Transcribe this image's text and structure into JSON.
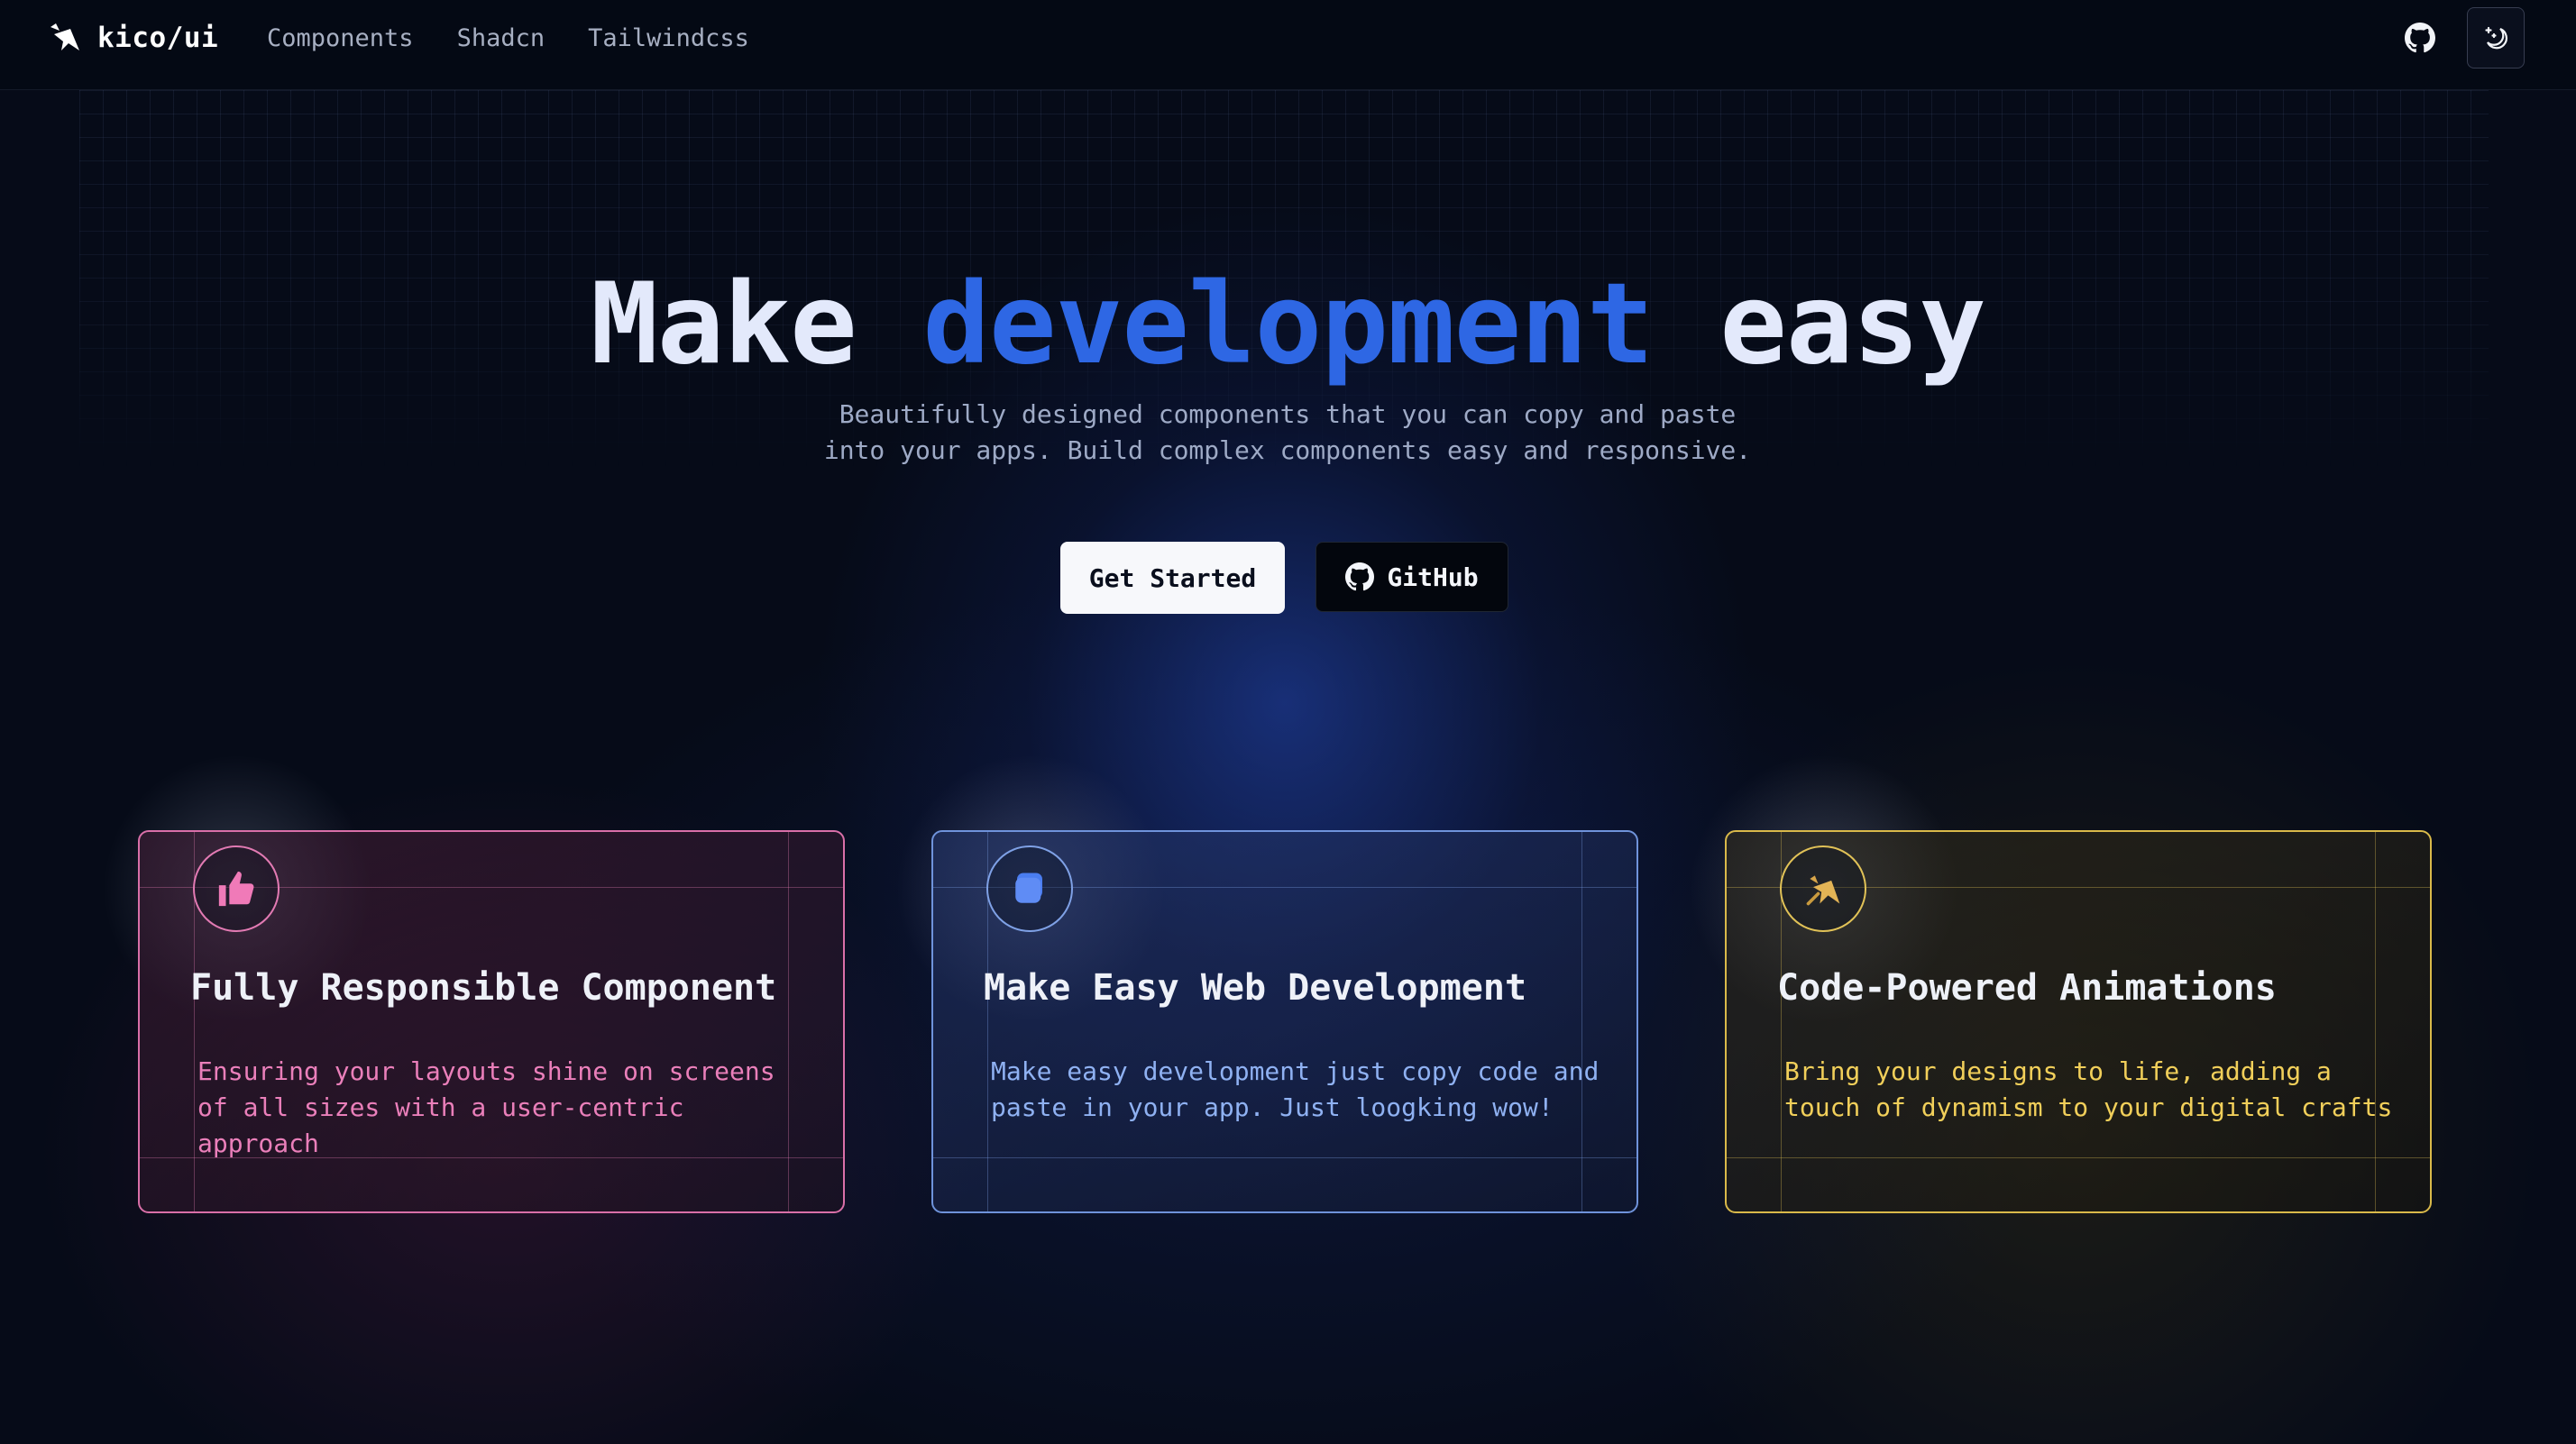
{
  "header": {
    "brand": "kico/ui",
    "nav": [
      {
        "label": "Components"
      },
      {
        "label": "Shadcn"
      },
      {
        "label": "Tailwindcss"
      }
    ],
    "icons": {
      "github": "github-icon",
      "theme": "moon-sparkle-icon"
    }
  },
  "hero": {
    "title_start": "Make",
    "title_accent": "development",
    "title_end": "easy",
    "subtitle_line1": "Beautifully designed components that you can copy and paste",
    "subtitle_line2": "into your apps. Build complex components easy and responsive.",
    "primary_button": "Get Started",
    "secondary_button": "GitHub"
  },
  "colors": {
    "accent": "#2e67e4",
    "pink": "#e27ab3",
    "blue": "#7fa1e6",
    "yellow": "#e1c257",
    "background": "#060b18"
  },
  "features": [
    {
      "icon": "thumbs-up-icon",
      "title": "Fully Responsible Component",
      "description": "Ensuring your layouts shine on screens of all sizes with a user-centric approach"
    },
    {
      "icon": "copy-squares-icon",
      "title": "Make Easy Web Development",
      "description": "Make easy development just copy code and paste in your app. Just loogking wow!"
    },
    {
      "icon": "pinned-sparkle-icon",
      "title": "Code-Powered Animations",
      "description": "Bring your designs to life, adding a touch of dynamism to your digital crafts"
    }
  ]
}
